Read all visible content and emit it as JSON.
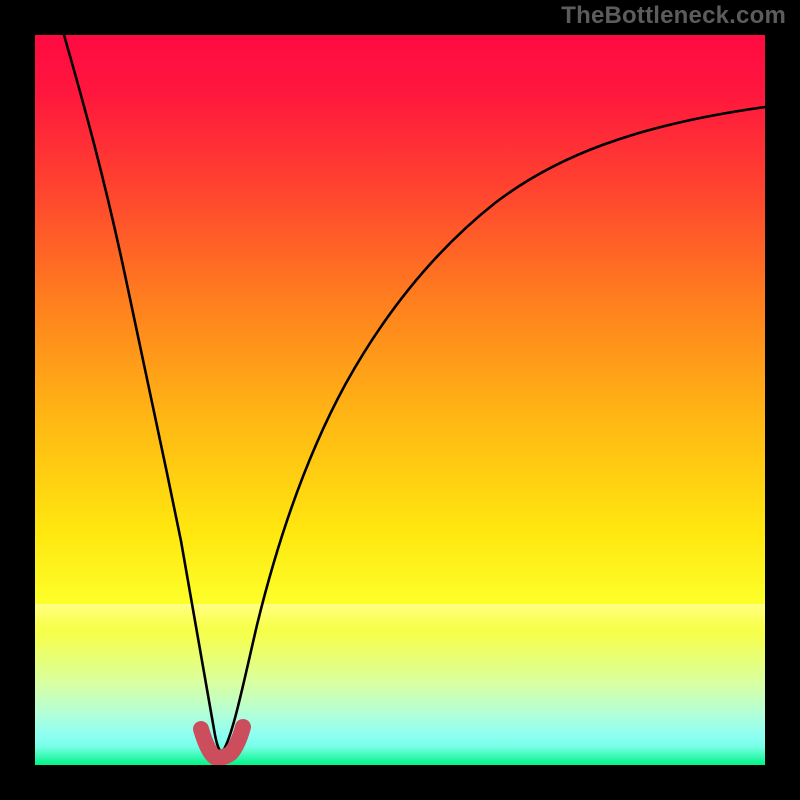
{
  "watermark": "TheBottleneck.com",
  "chart_data": {
    "type": "line",
    "title": "",
    "xlabel": "",
    "ylabel": "",
    "xlim": [
      0,
      100
    ],
    "ylim": [
      0,
      100
    ],
    "grid": false,
    "axes_visible": false,
    "background_gradient": [
      "#ff0a42",
      "#ffe70f",
      "#00f486"
    ],
    "series": [
      {
        "name": "bottleneck-curve",
        "color": "#000000",
        "x": [
          4,
          6,
          8,
          10,
          12,
          14,
          16,
          18,
          20,
          21,
          22,
          23,
          24,
          25,
          26,
          28,
          31,
          35,
          40,
          46,
          53,
          62,
          72,
          84,
          98
        ],
        "y": [
          100,
          90,
          80,
          70,
          58,
          46,
          33,
          20,
          9,
          5,
          2,
          1,
          2,
          4,
          8,
          16,
          27,
          38,
          48,
          57,
          65,
          72,
          78,
          83,
          87
        ]
      },
      {
        "name": "trough-highlight",
        "color": "#CC4E5C",
        "style": "thick-rounded",
        "x": [
          20.5,
          21.5,
          22.5,
          23.5,
          24.5,
          25.5
        ],
        "y": [
          4.2,
          2.2,
          1.2,
          1.4,
          2.6,
          4.8
        ]
      }
    ],
    "gradient_bands_y": {
      "red_start": 100,
      "orange_mid": 60,
      "yellow_mid": 30,
      "green_end": 0
    }
  },
  "colors": {
    "frame_border": "#000000",
    "curve": "#000000",
    "trough_marker": "#CC4E5C",
    "watermark_text": "#5c5c5c"
  }
}
